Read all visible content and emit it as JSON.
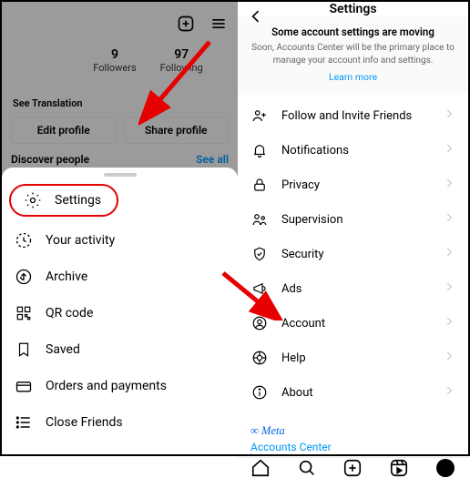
{
  "left": {
    "stats": [
      {
        "num": "9",
        "label": "Followers"
      },
      {
        "num": "97",
        "label": "Following"
      }
    ],
    "see_translation": "See Translation",
    "edit_profile": "Edit profile",
    "share_profile": "Share profile",
    "discover": "Discover people",
    "see_all": "See all",
    "menu": [
      {
        "label": "Settings"
      },
      {
        "label": "Your activity"
      },
      {
        "label": "Archive"
      },
      {
        "label": "QR code"
      },
      {
        "label": "Saved"
      },
      {
        "label": "Orders and payments"
      },
      {
        "label": "Close Friends"
      }
    ]
  },
  "right": {
    "title": "Settings",
    "banner": {
      "title": "Some account settings are moving",
      "desc": "Soon, Accounts Center will be the primary place to manage your account info and settings.",
      "learn": "Learn more"
    },
    "items": [
      {
        "label": "Follow and Invite Friends"
      },
      {
        "label": "Notifications"
      },
      {
        "label": "Privacy"
      },
      {
        "label": "Supervision"
      },
      {
        "label": "Security"
      },
      {
        "label": "Ads"
      },
      {
        "label": "Account"
      },
      {
        "label": "Help"
      },
      {
        "label": "About"
      }
    ],
    "meta": "Meta",
    "accounts_center": "Accounts Center"
  }
}
